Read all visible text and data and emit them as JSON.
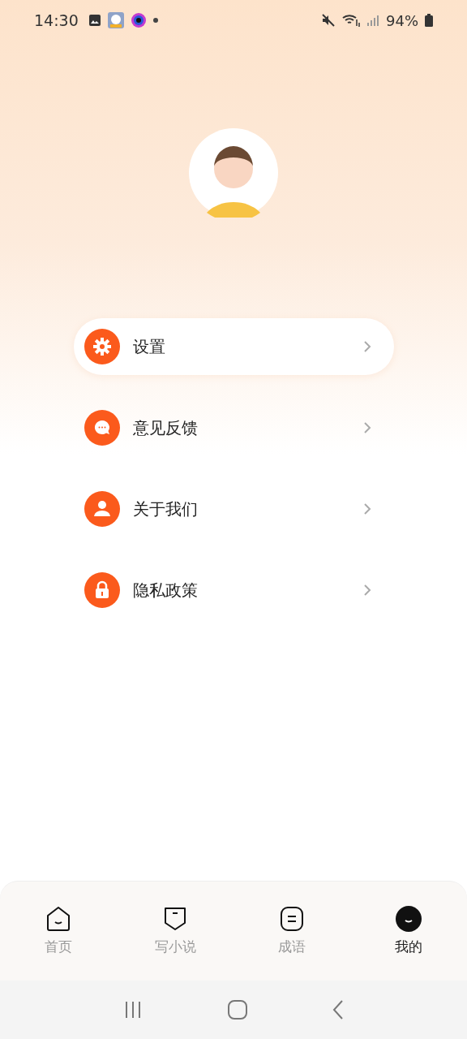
{
  "status_bar": {
    "time": "14:30",
    "battery": "94%"
  },
  "menu": [
    {
      "label": "设置",
      "selected": true
    },
    {
      "label": "意见反馈",
      "selected": false
    },
    {
      "label": "关于我们",
      "selected": false
    },
    {
      "label": "隐私政策",
      "selected": false
    }
  ],
  "tabs": [
    {
      "label": "首页",
      "selected": false
    },
    {
      "label": "写小说",
      "selected": false
    },
    {
      "label": "成语",
      "selected": false
    },
    {
      "label": "我的",
      "selected": true
    }
  ]
}
